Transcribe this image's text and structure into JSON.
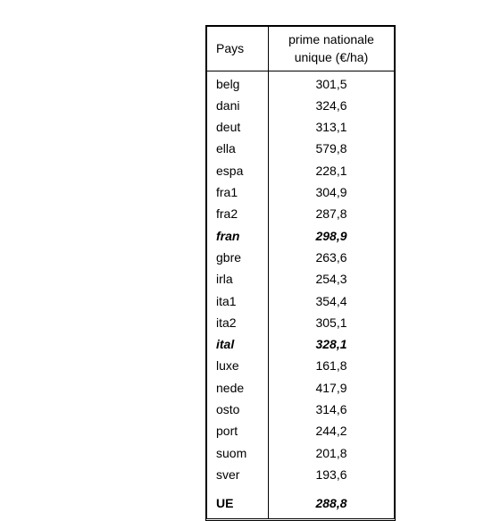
{
  "table": {
    "headers": {
      "pays": "Pays",
      "prime": "prime nationale unique (€/ha)"
    },
    "rows": [
      {
        "pays": "belg",
        "prime": "301,5",
        "emph": false
      },
      {
        "pays": "dani",
        "prime": "324,6",
        "emph": false
      },
      {
        "pays": "deut",
        "prime": "313,1",
        "emph": false
      },
      {
        "pays": "ella",
        "prime": "579,8",
        "emph": false
      },
      {
        "pays": "espa",
        "prime": "228,1",
        "emph": false
      },
      {
        "pays": "fra1",
        "prime": "304,9",
        "emph": false
      },
      {
        "pays": "fra2",
        "prime": "287,8",
        "emph": false
      },
      {
        "pays": "fran",
        "prime": "298,9",
        "emph": true
      },
      {
        "pays": "gbre",
        "prime": "263,6",
        "emph": false
      },
      {
        "pays": "irla",
        "prime": "254,3",
        "emph": false
      },
      {
        "pays": "ita1",
        "prime": "354,4",
        "emph": false
      },
      {
        "pays": "ita2",
        "prime": "305,1",
        "emph": false
      },
      {
        "pays": "ital",
        "prime": "328,1",
        "emph": true
      },
      {
        "pays": "luxe",
        "prime": "161,8",
        "emph": false
      },
      {
        "pays": "nede",
        "prime": "417,9",
        "emph": false
      },
      {
        "pays": "osto",
        "prime": "314,6",
        "emph": false
      },
      {
        "pays": "port",
        "prime": "244,2",
        "emph": false
      },
      {
        "pays": "suom",
        "prime": "201,8",
        "emph": false
      },
      {
        "pays": "sver",
        "prime": "193,6",
        "emph": false
      }
    ],
    "total": {
      "pays": "UE",
      "prime": "288,8"
    }
  }
}
